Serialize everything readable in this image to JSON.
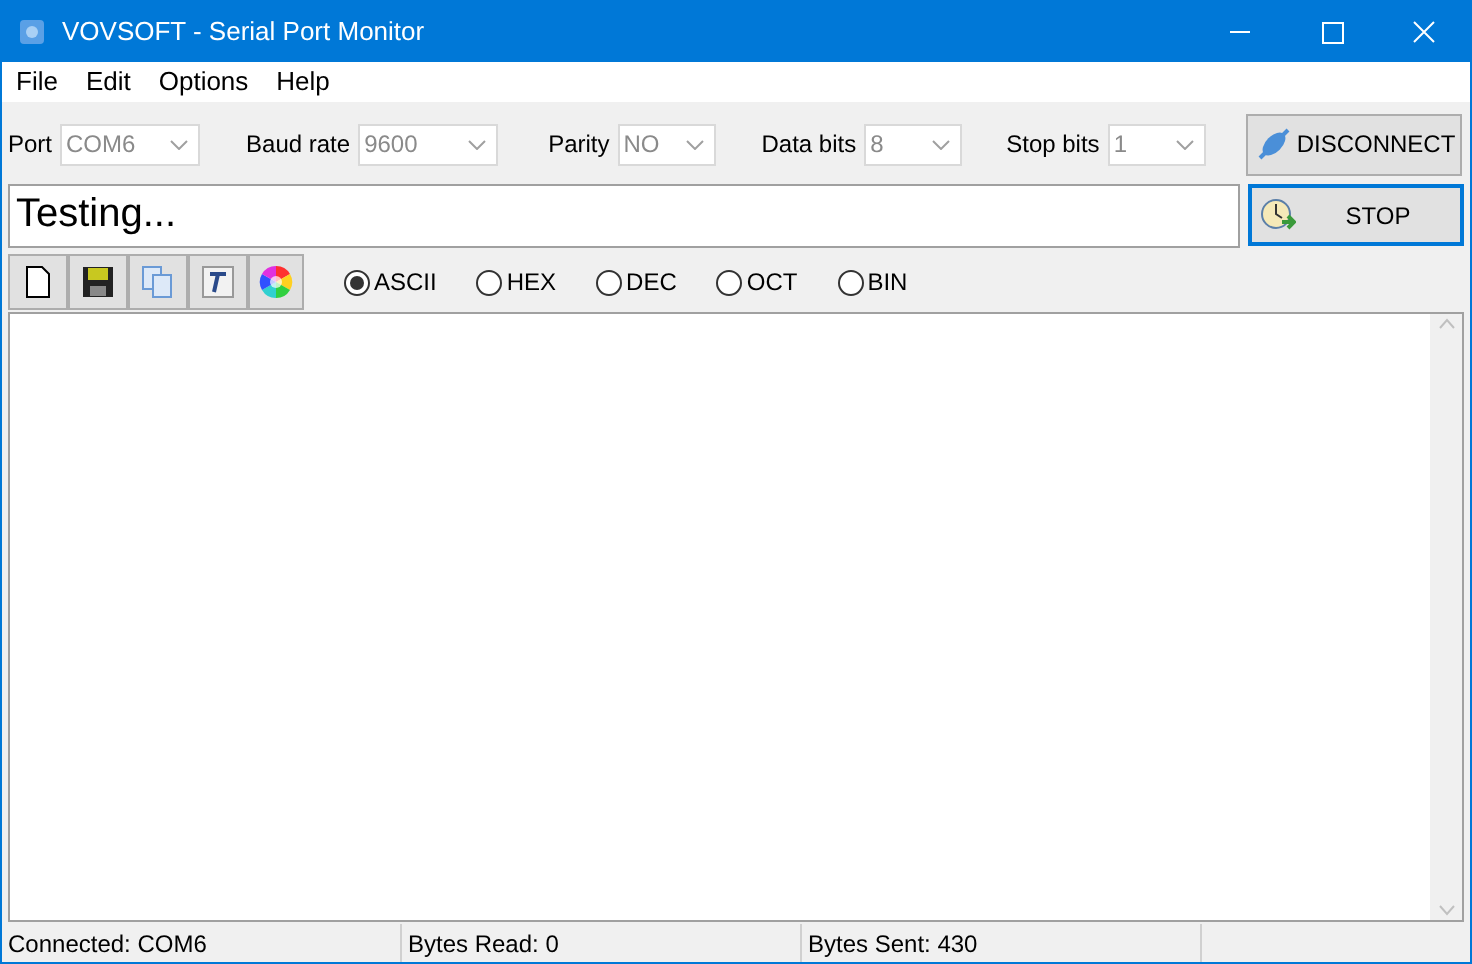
{
  "window": {
    "title": "VOVSOFT - Serial Port Monitor"
  },
  "menu": [
    "File",
    "Edit",
    "Options",
    "Help"
  ],
  "settings": [
    {
      "label": "Port",
      "value": "COM6"
    },
    {
      "label": "Baud rate",
      "value": "9600"
    },
    {
      "label": "Parity",
      "value": "NO"
    },
    {
      "label": "Data bits",
      "value": "8"
    },
    {
      "label": "Stop bits",
      "value": "1"
    }
  ],
  "disconnect_button": {
    "label": "DISCONNECT"
  },
  "send_field": {
    "value": "Testing..."
  },
  "stop_button": {
    "label": "STOP",
    "focused": true
  },
  "formats": [
    {
      "label": "ASCII",
      "selected": true
    },
    {
      "label": "HEX",
      "selected": false
    },
    {
      "label": "DEC",
      "selected": false
    },
    {
      "label": "OCT",
      "selected": false
    },
    {
      "label": "BIN",
      "selected": false
    }
  ],
  "status_bar": [
    "Connected: COM6",
    "Bytes Read: 0",
    "Bytes Sent: 430"
  ]
}
